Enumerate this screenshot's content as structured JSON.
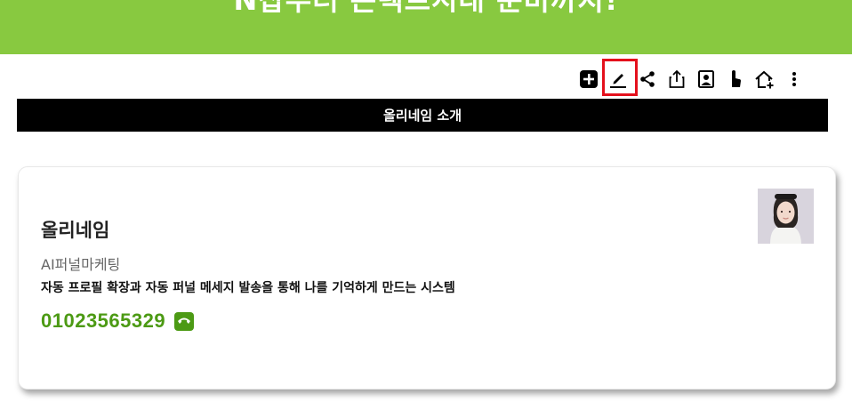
{
  "banner": {
    "text": "N잡부터 콘텍트시대 준비까지!"
  },
  "toolbar": {
    "icons": [
      "add-icon",
      "edit-icon",
      "share-icon",
      "export-icon",
      "image-icon",
      "touch-icon",
      "home-add-icon",
      "more-icon"
    ]
  },
  "section": {
    "title": "올리네임 소개"
  },
  "profile": {
    "name": "올리네임",
    "title": "AI퍼널마케팅",
    "description": "자동 프로필 확장과 자동 퍼널 메세지 발송을 통해 나를 기억하게 만드는 시스템",
    "phone": "01023565329"
  },
  "colors": {
    "accent_green": "#88c940",
    "phone_green": "#4c9a14",
    "highlight_red": "#e4101c"
  }
}
